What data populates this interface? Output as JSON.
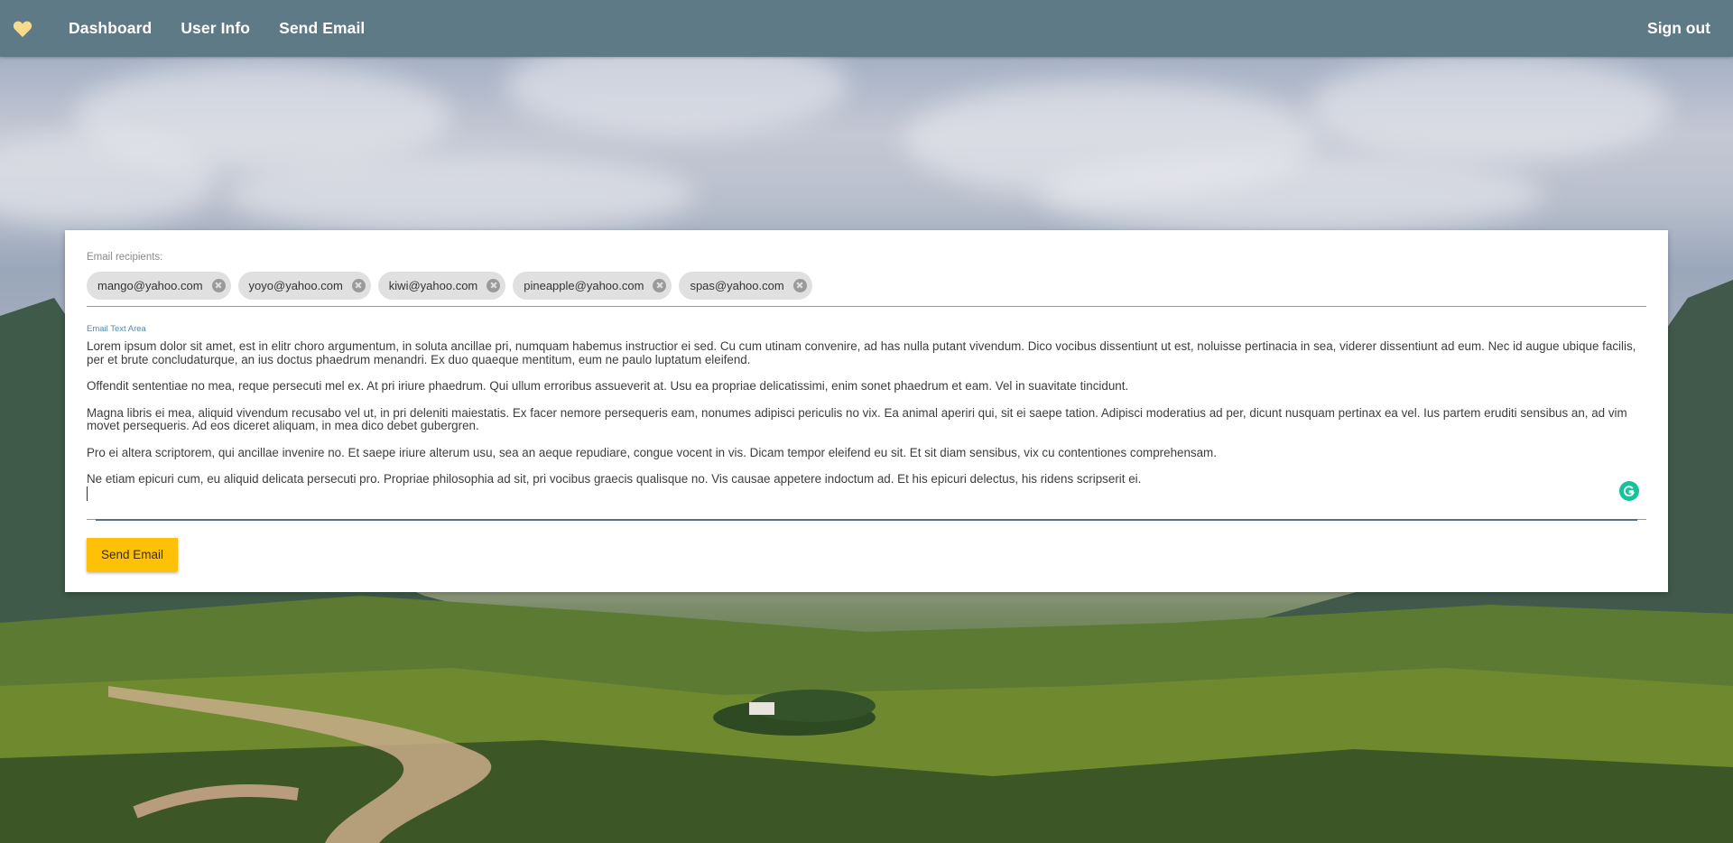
{
  "navbar": {
    "logo_icon": "heart-icon",
    "links": [
      "Dashboard",
      "User Info",
      "Send Email"
    ],
    "signout": "Sign out",
    "background": "#5f7a87",
    "logo_color": "#f4dc8c"
  },
  "form": {
    "recipients_label": "Email recipients:",
    "recipients": [
      "mango@yahoo.com",
      "yoyo@yahoo.com",
      "kiwi@yahoo.com",
      "pineapple@yahoo.com",
      "spas@yahoo.com"
    ],
    "chip_remove_icon": "close-circle-icon",
    "textarea_label": "Email Text Area",
    "paragraphs": [
      "Lorem ipsum dolor sit amet, est in elitr choro argumentum, in soluta ancillae pri, numquam habemus instructior ei sed. Cu cum utinam convenire, ad has nulla putant vivendum. Dico vocibus dissentiunt ut est, noluisse pertinacia in sea, viderer dissentiunt ad eum. Nec id augue ubique facilis, per et brute concludaturque, an ius doctus phaedrum menandri. Ex duo quaeque mentitum, eum ne paulo luptatum eleifend.",
      "Offendit sententiae no mea, reque persecuti mel ex. At pri iriure phaedrum. Qui ullum erroribus assueverit at. Usu ea propriae delicatissimi, enim sonet phaedrum et eam. Vel in suavitate tincidunt.",
      "Magna libris ei mea, aliquid vivendum recusabo vel ut, in pri deleniti maiestatis. Ex facer nemore persequeris eam, nonumes adipisci periculis no vix. Ea animal aperiri qui, sit ei saepe tation. Adipisci moderatius ad per, dicunt nusquam pertinax ea vel. Ius partem eruditi sensibus an, ad vim movet persequeris. Ad eos diceret aliquam, in mea dico debet gubergren.",
      "Pro ei altera scriptorem, qui ancillae invenire no. Et saepe iriure alterum usu, sea an aeque repudiare, congue vocent in vis. Dicam tempor eleifend eu sit. Et sit diam sensibus, vix cu contentiones comprehensam.",
      "Ne etiam epicuri cum, eu aliquid delicata persecuti pro. Propriae philosophia ad sit, pri vocibus graecis qualisque no. Vis causae appetere indoctum ad. Et his epicuri delectus, his ridens scripserit ei."
    ],
    "grammarly_icon": "grammarly-icon",
    "send_button": "Send Email",
    "accent": "#ffc107"
  }
}
